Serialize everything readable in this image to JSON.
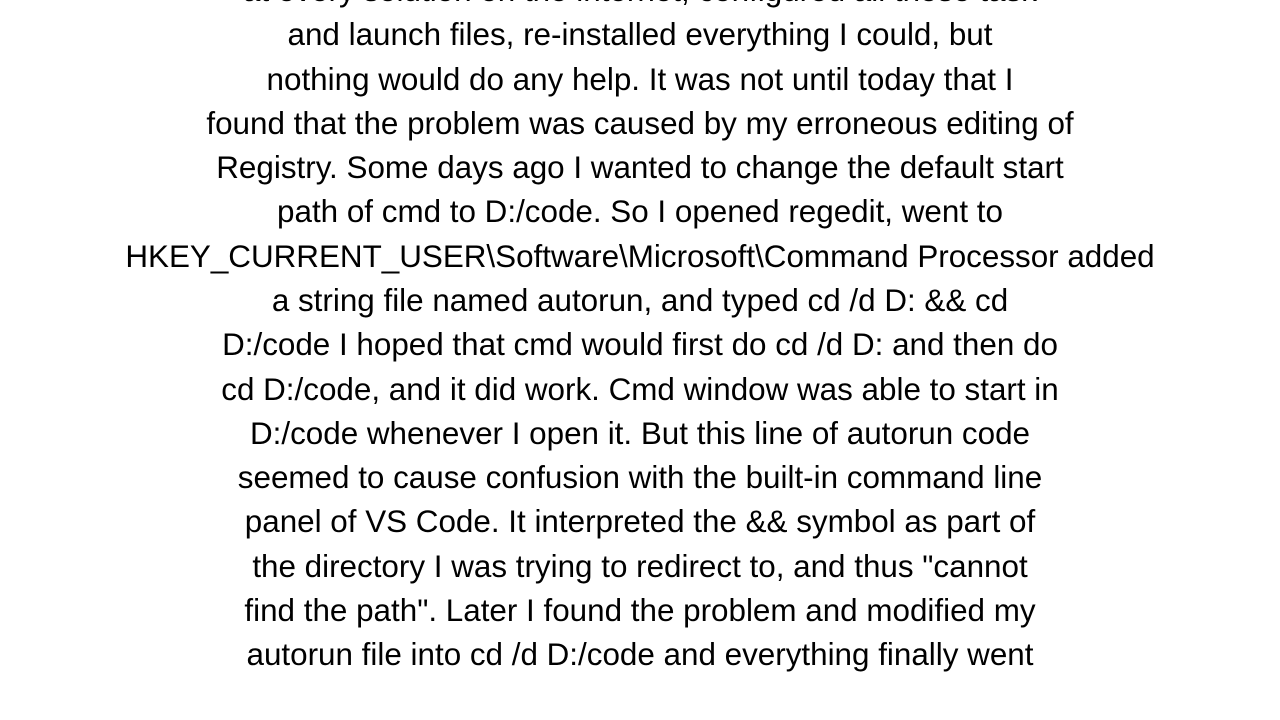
{
  "body": {
    "lines": [
      "at every solution on the internet, configured all those task",
      "and launch files, re-installed everything I could, but",
      "nothing would do any help. It was not until today that I",
      "found that the problem was caused by my erroneous editing of",
      "Registry. Some days ago I wanted to change the default start",
      "path of cmd to D:/code. So I opened regedit, went to",
      "HKEY_CURRENT_USER\\Software\\Microsoft\\Command Processor added",
      "a string file named autorun, and typed cd /d D: && cd",
      "D:/code I hoped that cmd would first do cd /d D: and then do",
      "cd D:/code, and it did work. Cmd window was able to start in",
      "D:/code whenever I open it. But this line of autorun code",
      "seemed to cause confusion with the built-in command line",
      "panel of VS Code. It interpreted the && symbol as part of",
      "the directory I was trying to redirect to, and thus \"cannot",
      "find the path\". Later I found the problem and modified my",
      "autorun file into cd /d D:/code and everything finally went"
    ]
  }
}
